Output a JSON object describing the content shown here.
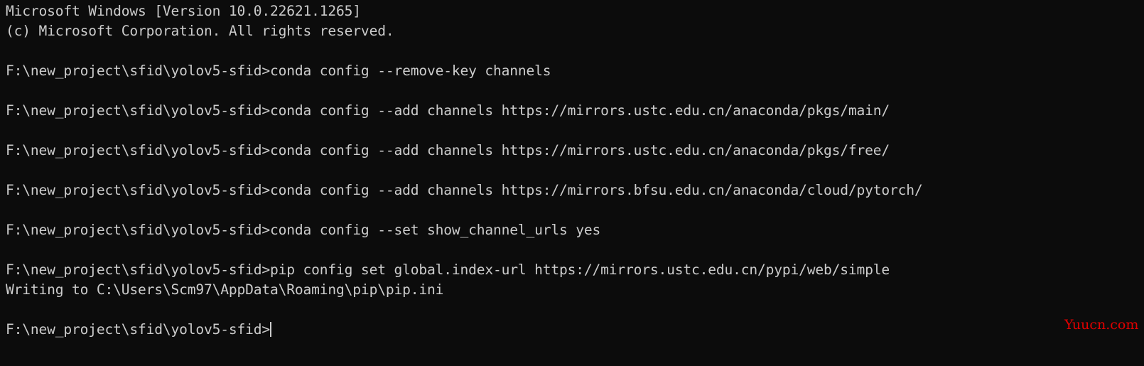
{
  "terminal": {
    "background_color": "#0c0c0c",
    "text_color": "#cccccc",
    "prompt": "F:\\new_project\\sfid\\yolov5-sfid>",
    "lines": [
      "Microsoft Windows [Version 10.0.22621.1265]",
      "(c) Microsoft Corporation. All rights reserved.",
      "",
      "F:\\new_project\\sfid\\yolov5-sfid>conda config --remove-key channels",
      "",
      "F:\\new_project\\sfid\\yolov5-sfid>conda config --add channels https://mirrors.ustc.edu.cn/anaconda/pkgs/main/",
      "",
      "F:\\new_project\\sfid\\yolov5-sfid>conda config --add channels https://mirrors.ustc.edu.cn/anaconda/pkgs/free/",
      "",
      "F:\\new_project\\sfid\\yolov5-sfid>conda config --add channels https://mirrors.bfsu.edu.cn/anaconda/cloud/pytorch/",
      "",
      "F:\\new_project\\sfid\\yolov5-sfid>conda config --set show_channel_urls yes",
      "",
      "F:\\new_project\\sfid\\yolov5-sfid>pip config set global.index-url https://mirrors.ustc.edu.cn/pypi/web/simple",
      "Writing to C:\\Users\\Scm97\\AppData\\Roaming\\pip\\pip.ini",
      ""
    ],
    "current_line": "F:\\new_project\\sfid\\yolov5-sfid>"
  },
  "watermark": {
    "text": "Yuucn.com",
    "color": "#e00000"
  }
}
